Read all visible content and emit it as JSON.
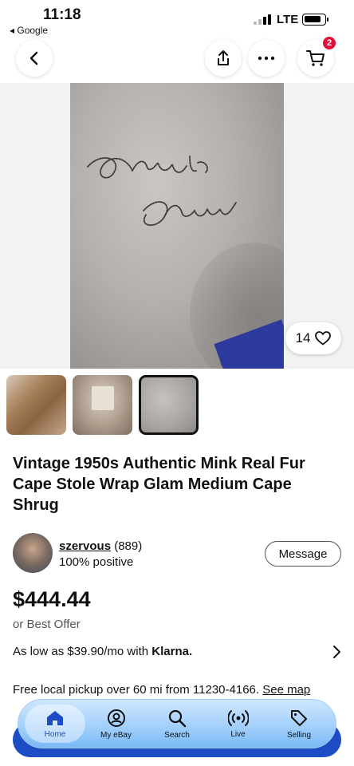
{
  "status_bar": {
    "time": "11:18",
    "back_app": "◂ Google",
    "network": "LTE"
  },
  "header": {
    "cart_count": "2"
  },
  "gallery": {
    "like_count": "14",
    "photo_signature": "Anita Lagano"
  },
  "listing": {
    "title": "Vintage 1950s Authentic Mink Real Fur Cape Stole Wrap Glam Medium Cape Shrug",
    "seller_name": "szervous",
    "seller_feedback": "(889)",
    "seller_positive": "100% positive",
    "message_label": "Message",
    "price": "$444.44",
    "best_offer": "or Best Offer",
    "financing_text": "As low as $39.90/mo with",
    "financing_brand": "Klarna.",
    "pickup_text": "Free local pickup over 60 mi from 11230-4166.",
    "see_map": "See map"
  },
  "nav": {
    "items": [
      {
        "label": "Home",
        "icon": "home-icon"
      },
      {
        "label": "My eBay",
        "icon": "user-icon"
      },
      {
        "label": "Search",
        "icon": "search-icon"
      },
      {
        "label": "Live",
        "icon": "live-icon"
      },
      {
        "label": "Selling",
        "icon": "tag-icon"
      }
    ]
  },
  "colors": {
    "accent": "#1d4cc4",
    "badge": "#e0103a"
  }
}
